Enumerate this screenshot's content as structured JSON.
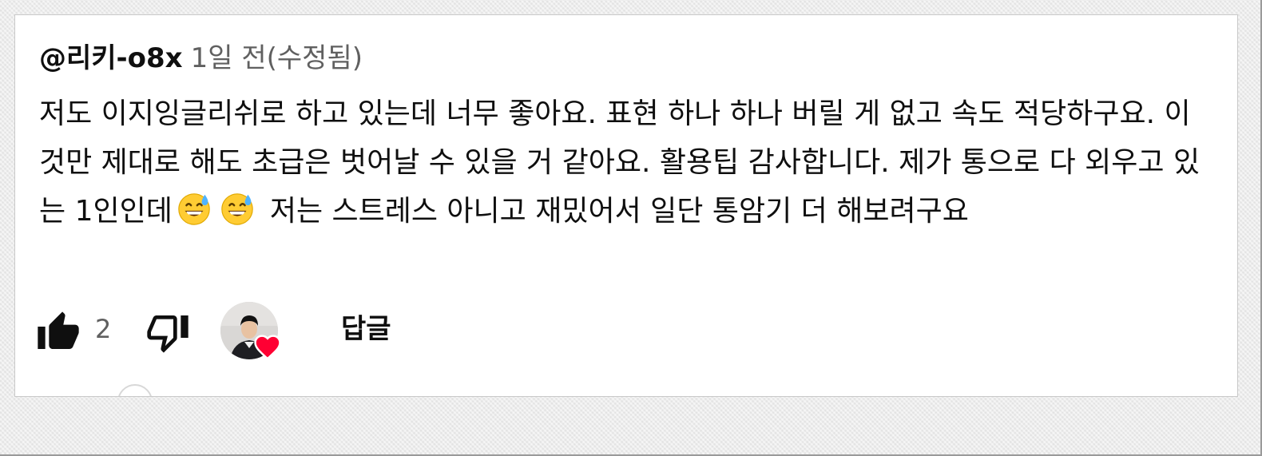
{
  "comment": {
    "author": "@리키-o8x",
    "meta": "1일 전(수정됨)",
    "text_before_emoji": "저도 이지잉글리쉬로 하고 있는데 너무 좋아요. 표현 하나 하나 버릴 게 없고 속도 적당하구요. 이것만 제대로 해도 초급은 벗어날 수 있을 거 같아요. 활용팁 감사합니다. 제가 통으로 다 외우고 있는 1인인데",
    "emojis": [
      "grinning-face-with-sweat",
      "grinning-face-with-sweat"
    ],
    "text_after_emoji": "저는 스트레스 아니고 재밌어서 일단 통암기 더 해보려구요",
    "like_count": "2",
    "reply_label": "답글",
    "creator_heart": true
  },
  "icons": {
    "like": "thumbs-up-filled-icon",
    "dislike": "thumbs-down-outline-icon",
    "heart": "heart-icon",
    "emoji": "grinning-face-with-sweat-icon"
  },
  "colors": {
    "author": "#0f0f0f",
    "meta": "#606060",
    "heart": "#ff0033",
    "background": "#ffffff"
  }
}
